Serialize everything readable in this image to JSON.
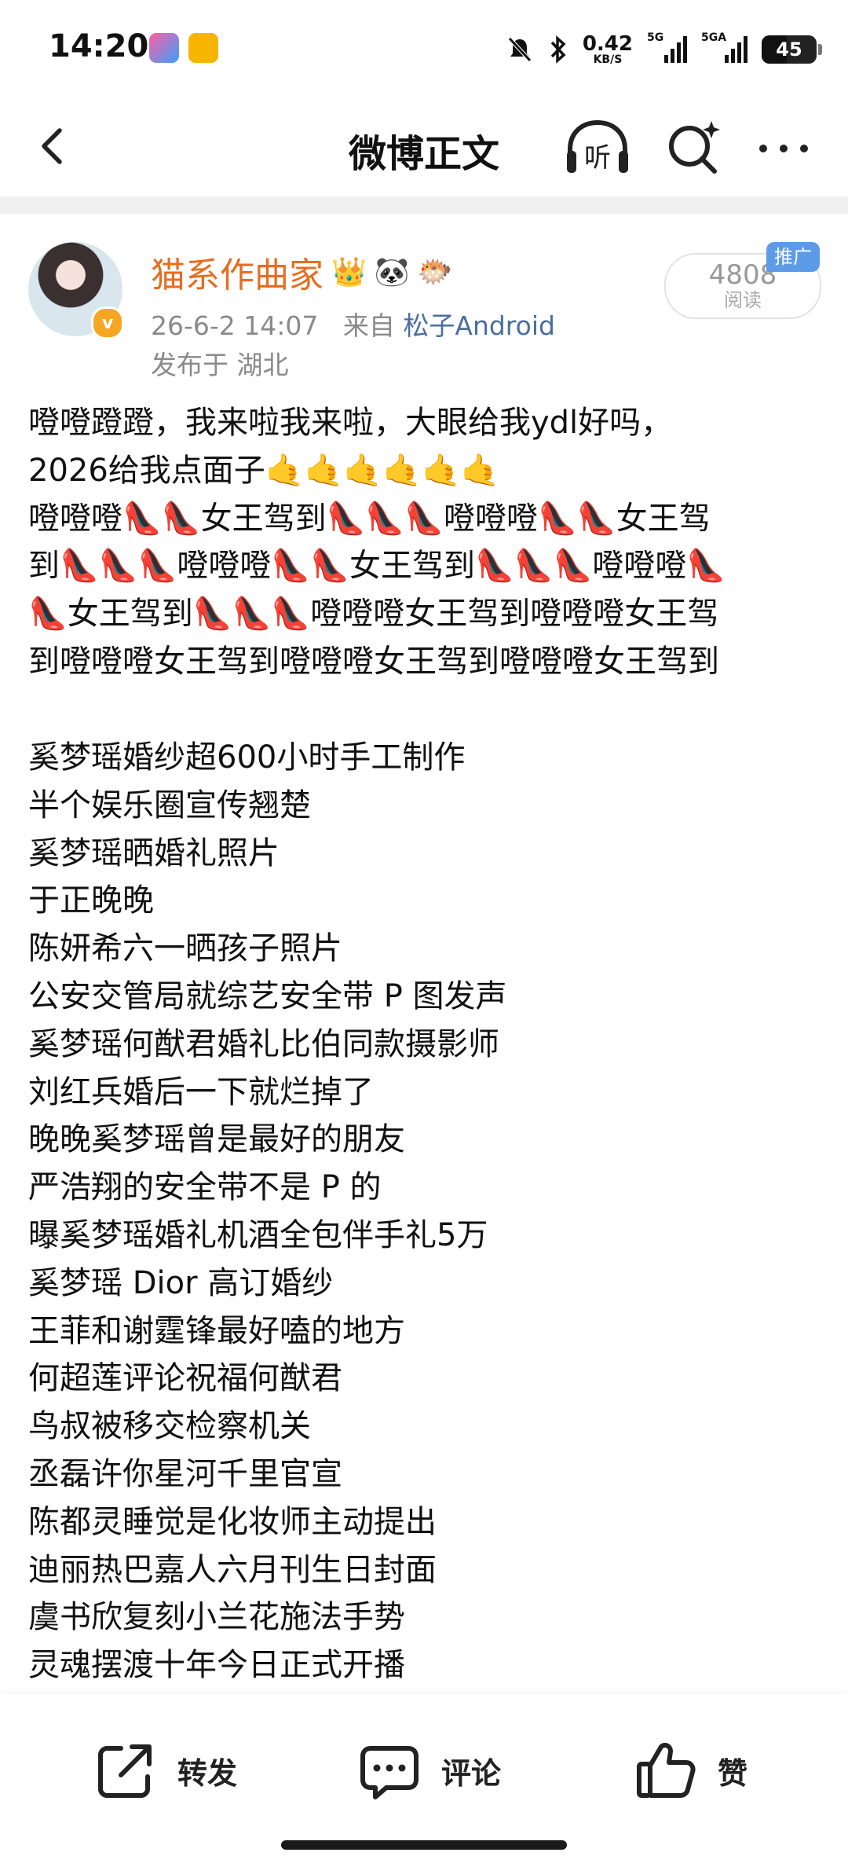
{
  "status_bar": {
    "time": "14:20",
    "net_speed_value": "0.42",
    "net_speed_unit": "KB/S",
    "signal1_label": "5G",
    "signal2_label": "5GA",
    "battery": "45"
  },
  "nav": {
    "title": "微博正文",
    "listen_label": "听"
  },
  "post": {
    "username": "猫系作曲家",
    "user_badges": [
      "👑",
      "🐼",
      "🐡"
    ],
    "verified_mark": "v",
    "date": "26-6-2 14:07",
    "source_prefix": "来自",
    "source": "松子Android",
    "location": "发布于 湖北",
    "read_count": "4808",
    "read_label": "阅读",
    "promo_label": "推广",
    "lines": [
      "噔噔蹬蹬，我来啦我来啦，大眼给我ydl好吗，",
      "2026给我点面子🤙🤙🤙🤙🤙🤙",
      "噔噔噔👠👠女王驾到👠👠👠噔噔噔👠👠女王驾",
      "到👠👠👠噔噔噔👠👠女王驾到👠👠👠噔噔噔👠",
      "👠女王驾到👠👠👠噔噔噔女王驾到噔噔噔女王驾",
      "到噔噔噔女王驾到噔噔噔女王驾到噔噔噔女王驾到"
    ],
    "hot_topics": [
      "奚梦瑶婚纱超600小时手工制作",
      "半个娱乐圈宣传翘楚",
      "奚梦瑶晒婚礼照片",
      "于正晚晚",
      "陈妍希六一晒孩子照片",
      "公安交管局就综艺安全带 P 图发声",
      "奚梦瑶何猷君婚礼比伯同款摄影师",
      "刘红兵婚后一下就烂掉了",
      "晚晚奚梦瑶曾是最好的朋友",
      "严浩翔的安全带不是 P 的",
      "曝奚梦瑶婚礼机酒全包伴手礼5万",
      "奚梦瑶 Dior 高订婚纱",
      "王菲和谢霆锋最好嗑的地方",
      "何超莲评论祝福何猷君",
      "鸟叔被移交检察机关",
      "丞磊许你星河千里官宣",
      "陈都灵睡觉是化妆师主动提出",
      "迪丽热巴嘉人六月刊生日封面",
      "虞书欣复刻小兰花施法手势",
      "灵魂摆渡十年今日正式开播"
    ]
  },
  "actions": {
    "repost": "转发",
    "comment": "评论",
    "like": "赞"
  },
  "colors": {
    "username": "#e86c1f",
    "source": "#4a6ea0",
    "promo": "#5b9be8"
  }
}
